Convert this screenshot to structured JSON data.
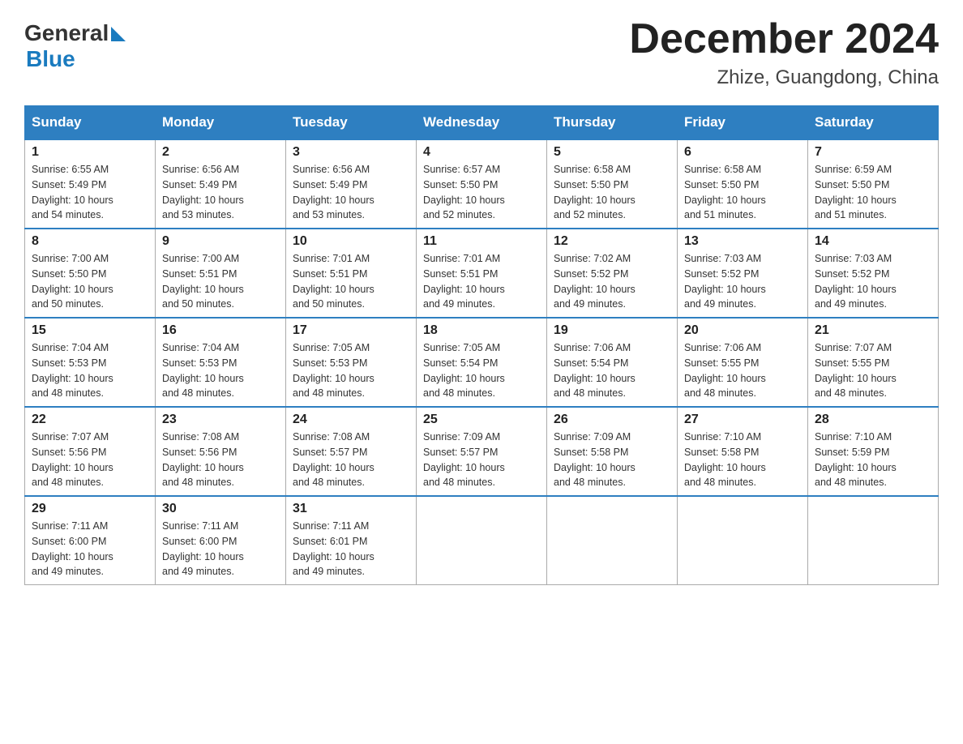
{
  "logo": {
    "general": "General",
    "blue": "Blue"
  },
  "title": {
    "month": "December 2024",
    "location": "Zhize, Guangdong, China"
  },
  "weekdays": [
    "Sunday",
    "Monday",
    "Tuesday",
    "Wednesday",
    "Thursday",
    "Friday",
    "Saturday"
  ],
  "weeks": [
    [
      {
        "day": "1",
        "sunrise": "6:55 AM",
        "sunset": "5:49 PM",
        "daylight": "10 hours and 54 minutes."
      },
      {
        "day": "2",
        "sunrise": "6:56 AM",
        "sunset": "5:49 PM",
        "daylight": "10 hours and 53 minutes."
      },
      {
        "day": "3",
        "sunrise": "6:56 AM",
        "sunset": "5:49 PM",
        "daylight": "10 hours and 53 minutes."
      },
      {
        "day": "4",
        "sunrise": "6:57 AM",
        "sunset": "5:50 PM",
        "daylight": "10 hours and 52 minutes."
      },
      {
        "day": "5",
        "sunrise": "6:58 AM",
        "sunset": "5:50 PM",
        "daylight": "10 hours and 52 minutes."
      },
      {
        "day": "6",
        "sunrise": "6:58 AM",
        "sunset": "5:50 PM",
        "daylight": "10 hours and 51 minutes."
      },
      {
        "day": "7",
        "sunrise": "6:59 AM",
        "sunset": "5:50 PM",
        "daylight": "10 hours and 51 minutes."
      }
    ],
    [
      {
        "day": "8",
        "sunrise": "7:00 AM",
        "sunset": "5:50 PM",
        "daylight": "10 hours and 50 minutes."
      },
      {
        "day": "9",
        "sunrise": "7:00 AM",
        "sunset": "5:51 PM",
        "daylight": "10 hours and 50 minutes."
      },
      {
        "day": "10",
        "sunrise": "7:01 AM",
        "sunset": "5:51 PM",
        "daylight": "10 hours and 50 minutes."
      },
      {
        "day": "11",
        "sunrise": "7:01 AM",
        "sunset": "5:51 PM",
        "daylight": "10 hours and 49 minutes."
      },
      {
        "day": "12",
        "sunrise": "7:02 AM",
        "sunset": "5:52 PM",
        "daylight": "10 hours and 49 minutes."
      },
      {
        "day": "13",
        "sunrise": "7:03 AM",
        "sunset": "5:52 PM",
        "daylight": "10 hours and 49 minutes."
      },
      {
        "day": "14",
        "sunrise": "7:03 AM",
        "sunset": "5:52 PM",
        "daylight": "10 hours and 49 minutes."
      }
    ],
    [
      {
        "day": "15",
        "sunrise": "7:04 AM",
        "sunset": "5:53 PM",
        "daylight": "10 hours and 48 minutes."
      },
      {
        "day": "16",
        "sunrise": "7:04 AM",
        "sunset": "5:53 PM",
        "daylight": "10 hours and 48 minutes."
      },
      {
        "day": "17",
        "sunrise": "7:05 AM",
        "sunset": "5:53 PM",
        "daylight": "10 hours and 48 minutes."
      },
      {
        "day": "18",
        "sunrise": "7:05 AM",
        "sunset": "5:54 PM",
        "daylight": "10 hours and 48 minutes."
      },
      {
        "day": "19",
        "sunrise": "7:06 AM",
        "sunset": "5:54 PM",
        "daylight": "10 hours and 48 minutes."
      },
      {
        "day": "20",
        "sunrise": "7:06 AM",
        "sunset": "5:55 PM",
        "daylight": "10 hours and 48 minutes."
      },
      {
        "day": "21",
        "sunrise": "7:07 AM",
        "sunset": "5:55 PM",
        "daylight": "10 hours and 48 minutes."
      }
    ],
    [
      {
        "day": "22",
        "sunrise": "7:07 AM",
        "sunset": "5:56 PM",
        "daylight": "10 hours and 48 minutes."
      },
      {
        "day": "23",
        "sunrise": "7:08 AM",
        "sunset": "5:56 PM",
        "daylight": "10 hours and 48 minutes."
      },
      {
        "day": "24",
        "sunrise": "7:08 AM",
        "sunset": "5:57 PM",
        "daylight": "10 hours and 48 minutes."
      },
      {
        "day": "25",
        "sunrise": "7:09 AM",
        "sunset": "5:57 PM",
        "daylight": "10 hours and 48 minutes."
      },
      {
        "day": "26",
        "sunrise": "7:09 AM",
        "sunset": "5:58 PM",
        "daylight": "10 hours and 48 minutes."
      },
      {
        "day": "27",
        "sunrise": "7:10 AM",
        "sunset": "5:58 PM",
        "daylight": "10 hours and 48 minutes."
      },
      {
        "day": "28",
        "sunrise": "7:10 AM",
        "sunset": "5:59 PM",
        "daylight": "10 hours and 48 minutes."
      }
    ],
    [
      {
        "day": "29",
        "sunrise": "7:11 AM",
        "sunset": "6:00 PM",
        "daylight": "10 hours and 49 minutes."
      },
      {
        "day": "30",
        "sunrise": "7:11 AM",
        "sunset": "6:00 PM",
        "daylight": "10 hours and 49 minutes."
      },
      {
        "day": "31",
        "sunrise": "7:11 AM",
        "sunset": "6:01 PM",
        "daylight": "10 hours and 49 minutes."
      },
      null,
      null,
      null,
      null
    ]
  ],
  "labels": {
    "sunrise": "Sunrise:",
    "sunset": "Sunset:",
    "daylight": "Daylight:"
  }
}
